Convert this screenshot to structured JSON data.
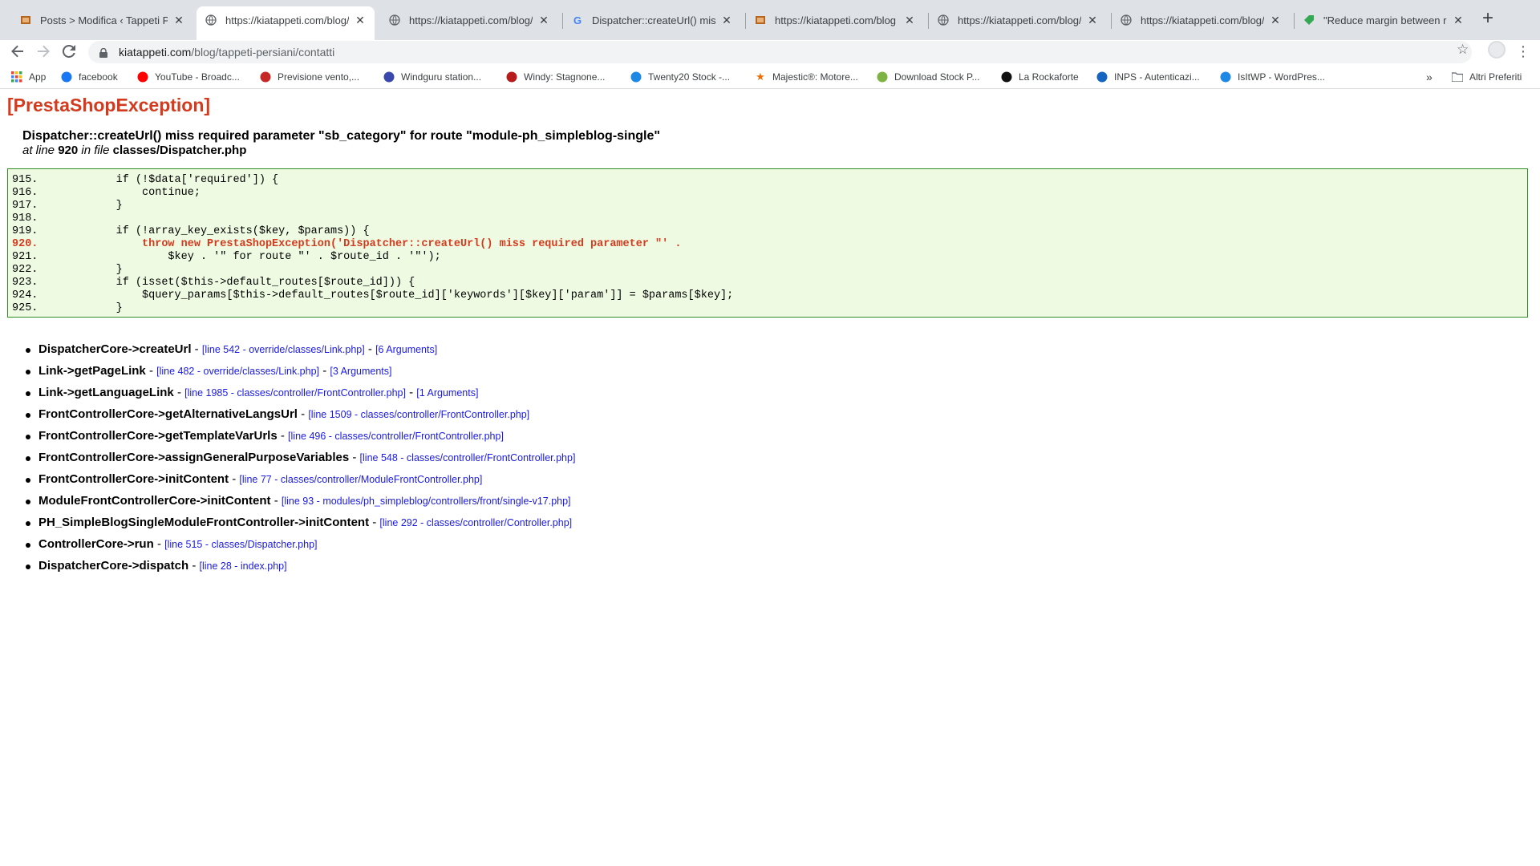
{
  "tabs": [
    {
      "title": "Posts > Modifica ‹ Tappeti Persiani",
      "icon": "tappeti-favicon-icon",
      "active": false
    },
    {
      "title": "https://kiatappeti.com/blog/tappeti-persiani/contatti",
      "icon": "globe-icon",
      "active": true
    },
    {
      "title": "https://kiatappeti.com/blog/n",
      "icon": "globe-icon",
      "active": false
    },
    {
      "title": "Dispatcher::createUrl() miss required",
      "icon": "google-icon",
      "active": false
    },
    {
      "title": "https://kiatappeti.com/blog",
      "icon": "tappeti-favicon-icon",
      "active": false
    },
    {
      "title": "https://kiatappeti.com/blog/n",
      "icon": "globe-icon",
      "active": false
    },
    {
      "title": "https://kiatappeti.com/blog/n",
      "icon": "globe-icon",
      "active": false
    },
    {
      "title": "\"Reduce margin between rows",
      "icon": "tag-icon",
      "active": false
    }
  ],
  "address": {
    "host": "kiatappeti.com",
    "path": "/blog/tappeti-persiani/contatti"
  },
  "bookmarks": [
    {
      "label": "App",
      "icon": "apps-grid-icon"
    },
    {
      "label": "facebook",
      "icon": "facebook-icon"
    },
    {
      "label": "YouTube - Broadc...",
      "icon": "youtube-icon"
    },
    {
      "label": "Previsione vento,...",
      "icon": "windsurf-icon"
    },
    {
      "label": "Windguru station...",
      "icon": "windguru-icon"
    },
    {
      "label": "Windy: Stagnone...",
      "icon": "windy-icon"
    },
    {
      "label": "Twenty20 Stock -...",
      "icon": "twenty20-icon"
    },
    {
      "label": "Majestic®: Motore...",
      "icon": "star-orange-icon"
    },
    {
      "label": "Download Stock P...",
      "icon": "leaf-icon"
    },
    {
      "label": "La Rockaforte",
      "icon": "g-black-icon"
    },
    {
      "label": "INPS - Autenticazi...",
      "icon": "inps-icon"
    },
    {
      "label": "IsItWP - WordPres...",
      "icon": "wp-icon"
    }
  ],
  "bookmarks_more": "»",
  "other_bookmarks": "Altri Preferiti",
  "exception": {
    "title": "[PrestaShopException]",
    "message": "Dispatcher::createUrl() miss required parameter \"sb_category\" for route \"module-ph_simpleblog-single\"",
    "at_line_prefix": "at line",
    "line": "920",
    "in_file_prefix": "in file",
    "file": "classes/Dispatcher.php"
  },
  "code_lines": [
    {
      "num": "915.",
      "text": "            if (!$data['required']) {",
      "highlight": false
    },
    {
      "num": "916.",
      "text": "                continue;",
      "highlight": false
    },
    {
      "num": "917.",
      "text": "            }",
      "highlight": false
    },
    {
      "num": "918.",
      "text": "",
      "highlight": false
    },
    {
      "num": "919.",
      "text": "            if (!array_key_exists($key, $params)) {",
      "highlight": false
    },
    {
      "num": "920.",
      "text": "                throw new PrestaShopException('Dispatcher::createUrl() miss required parameter \"' .",
      "highlight": true
    },
    {
      "num": "921.",
      "text": "                    $key . '\" for route \"' . $route_id . '\"');",
      "highlight": false
    },
    {
      "num": "922.",
      "text": "            }",
      "highlight": false
    },
    {
      "num": "923.",
      "text": "            if (isset($this->default_routes[$route_id])) {",
      "highlight": false
    },
    {
      "num": "924.",
      "text": "                $query_params[$this->default_routes[$route_id]['keywords'][$key]['param']] = $params[$key];",
      "highlight": false
    },
    {
      "num": "925.",
      "text": "            }",
      "highlight": false
    }
  ],
  "trace": [
    {
      "fn": "DispatcherCore->createUrl",
      "loc": "[line 542 - override/classes/Link.php]",
      "args": "[6 Arguments]"
    },
    {
      "fn": "Link->getPageLink",
      "loc": "[line 482 - override/classes/Link.php]",
      "args": "[3 Arguments]"
    },
    {
      "fn": "Link->getLanguageLink",
      "loc": "[line 1985 - classes/controller/FrontController.php]",
      "args": "[1 Arguments]"
    },
    {
      "fn": "FrontControllerCore->getAlternativeLangsUrl",
      "loc": "[line 1509 - classes/controller/FrontController.php]",
      "args": ""
    },
    {
      "fn": "FrontControllerCore->getTemplateVarUrls",
      "loc": "[line 496 - classes/controller/FrontController.php]",
      "args": ""
    },
    {
      "fn": "FrontControllerCore->assignGeneralPurposeVariables",
      "loc": "[line 548 - classes/controller/FrontController.php]",
      "args": ""
    },
    {
      "fn": "FrontControllerCore->initContent",
      "loc": "[line 77 - classes/controller/ModuleFrontController.php]",
      "args": ""
    },
    {
      "fn": "ModuleFrontControllerCore->initContent",
      "loc": "[line 93 - modules/ph_simpleblog/controllers/front/single-v17.php]",
      "args": ""
    },
    {
      "fn": "PH_SimpleBlogSingleModuleFrontController->initContent",
      "loc": "[line 292 - classes/controller/Controller.php]",
      "args": ""
    },
    {
      "fn": "ControllerCore->run",
      "loc": "[line 515 - classes/Dispatcher.php]",
      "args": ""
    },
    {
      "fn": "DispatcherCore->dispatch",
      "loc": "[line 28 - index.php]",
      "args": ""
    }
  ],
  "separator": "-"
}
